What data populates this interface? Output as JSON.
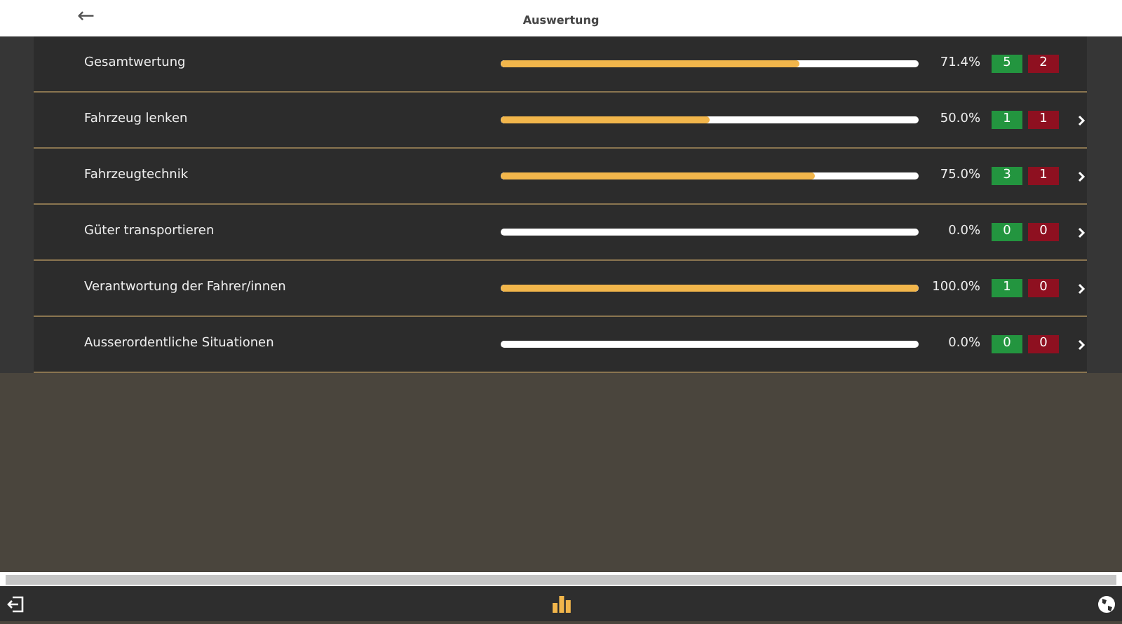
{
  "header": {
    "back_icon": "←",
    "title": "Auswertung"
  },
  "rows": [
    {
      "label": "Gesamtwertung",
      "level": 0.714,
      "reading": "71.4%",
      "correct": "5",
      "wrong": "2",
      "expandable": false
    },
    {
      "label": "Fahrzeug lenken",
      "level": 0.5,
      "reading": "50.0%",
      "correct": "1",
      "wrong": "1",
      "expandable": true
    },
    {
      "label": "Fahrzeugtechnik",
      "level": 0.75,
      "reading": "75.0%",
      "correct": "3",
      "wrong": "1",
      "expandable": true
    },
    {
      "label": "Güter transportieren",
      "level": 0,
      "reading": "0.0%",
      "correct": "0",
      "wrong": "0",
      "expandable": true
    },
    {
      "label": "Verantwortung der Fahrer/innen",
      "level": 1,
      "reading": "100.0%",
      "correct": "1",
      "wrong": "0",
      "expandable": true
    },
    {
      "label": "Ausserordentliche Situationen",
      "level": 0,
      "reading": "0.0%",
      "correct": "0",
      "wrong": "0",
      "expandable": true
    }
  ]
}
